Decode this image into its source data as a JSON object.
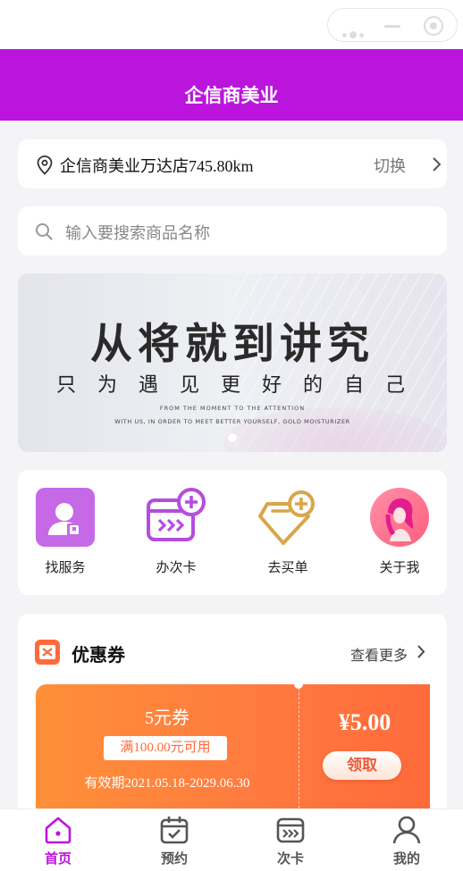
{
  "header": {
    "title": "企信商美业"
  },
  "location": {
    "store": "企信商美业万达店745.80km",
    "switch_label": "切换"
  },
  "search": {
    "placeholder": "输入要搜索商品名称"
  },
  "banner": {
    "headline": "从将就到讲究",
    "subline": "只为遇见更好的自己",
    "english_line1": "FROM THE MOMENT TO THE ATTENTION",
    "english_line2": "WITH US, IN ORDER TO MEET BETTER YOURSELF, GOLD MOISTURIZER"
  },
  "menu": {
    "items": [
      {
        "label": "找服务",
        "icon": "user-card-icon"
      },
      {
        "label": "办次卡",
        "icon": "add-card-icon"
      },
      {
        "label": "去买单",
        "icon": "diamond-add-icon"
      },
      {
        "label": "关于我",
        "icon": "woman-avatar-icon"
      }
    ]
  },
  "coupons": {
    "title": "优惠券",
    "more_label": "查看更多",
    "items": [
      {
        "name": "5元券",
        "condition": "满100.00元可用",
        "validity": "有效期2021.05.18-2029.06.30",
        "price": "¥5.00",
        "claim_label": "领取"
      }
    ]
  },
  "tabbar": {
    "items": [
      {
        "label": "首页",
        "icon": "home-icon",
        "active": true
      },
      {
        "label": "预约",
        "icon": "calendar-icon",
        "active": false
      },
      {
        "label": "次卡",
        "icon": "card-icon",
        "active": false
      },
      {
        "label": "我的",
        "icon": "profile-icon",
        "active": false
      }
    ]
  },
  "colors": {
    "brand": "#bb14dd",
    "coupon_start": "#ff8f38",
    "coupon_end": "#ff6a3b",
    "background": "#f4f4f6"
  }
}
